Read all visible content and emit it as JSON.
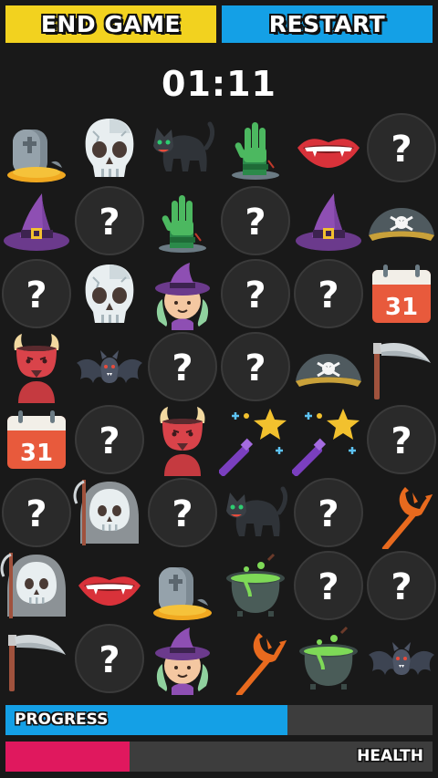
{
  "header": {
    "end_game_label": "END GAME",
    "restart_label": "RESTART",
    "timer": "01:11"
  },
  "grid": {
    "rows": 8,
    "cols": 6,
    "cells": [
      [
        "tombstone",
        "skull",
        "black-cat",
        "zombie-hand",
        "vampire-lips",
        "hidden"
      ],
      [
        "witch-hat",
        "hidden",
        "zombie-hand",
        "hidden",
        "witch-hat",
        "pirate-hat"
      ],
      [
        "hidden",
        "skull",
        "witch",
        "hidden",
        "hidden",
        "calendar"
      ],
      [
        "devil",
        "bat",
        "hidden",
        "hidden",
        "pirate-hat",
        "scythe"
      ],
      [
        "calendar",
        "hidden",
        "devil",
        "magic-wand",
        "magic-wand",
        "hidden"
      ],
      [
        "hidden",
        "reaper",
        "hidden",
        "black-cat",
        "hidden",
        "trident"
      ],
      [
        "reaper",
        "vampire-lips",
        "tombstone",
        "cauldron",
        "hidden",
        "hidden"
      ],
      [
        "scythe",
        "hidden",
        "witch",
        "trident",
        "cauldron",
        "bat"
      ]
    ]
  },
  "calendar_day": "31",
  "progress": {
    "label": "PROGRESS",
    "value": 0.66,
    "color": "#14a0e6"
  },
  "health": {
    "label": "HEALTH",
    "value": 0.29,
    "color": "#e0185e"
  },
  "colors": {
    "background": "#191919",
    "end_game": "#f2d21f",
    "restart": "#14a0e6",
    "hidden_tile": "#2a2a2a"
  }
}
